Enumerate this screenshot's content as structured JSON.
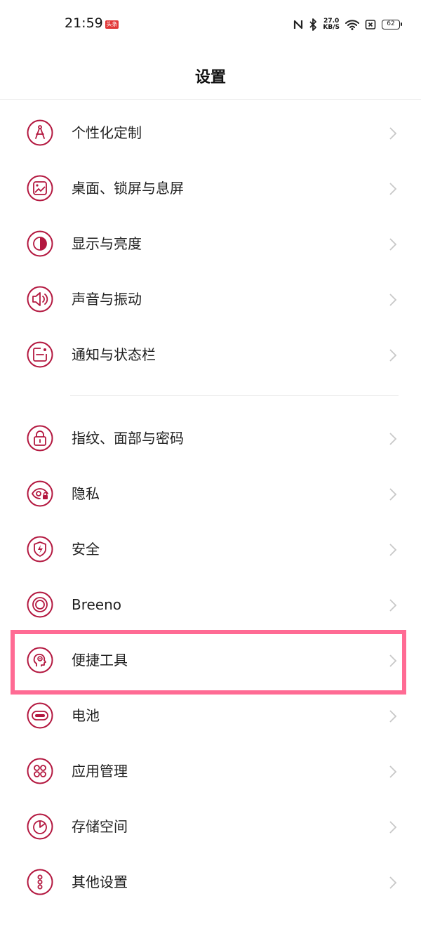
{
  "status_bar": {
    "time": "21:59",
    "app_badge": "头条",
    "net_speed_value": "27.0",
    "net_speed_unit": "KB/S",
    "battery": "62"
  },
  "header": {
    "title": "设置"
  },
  "accent_color": "#b3173f",
  "groups": [
    {
      "items": [
        {
          "label": "个性化定制",
          "icon": "compass-icon"
        },
        {
          "label": "桌面、锁屏与息屏",
          "icon": "wallpaper-icon"
        },
        {
          "label": "显示与亮度",
          "icon": "contrast-icon"
        },
        {
          "label": "声音与振动",
          "icon": "speaker-icon"
        },
        {
          "label": "通知与状态栏",
          "icon": "notification-icon"
        }
      ]
    },
    {
      "items": [
        {
          "label": "指纹、面部与密码",
          "icon": "lock-icon"
        },
        {
          "label": "隐私",
          "icon": "privacy-eye-icon"
        },
        {
          "label": "安全",
          "icon": "shield-icon"
        },
        {
          "label": "Breeno",
          "icon": "breeno-icon"
        },
        {
          "label": "便捷工具",
          "icon": "head-icon"
        },
        {
          "label": "电池",
          "icon": "battery-icon"
        },
        {
          "label": "应用管理",
          "icon": "apps-icon"
        },
        {
          "label": "存储空间",
          "icon": "storage-icon"
        },
        {
          "label": "其他设置",
          "icon": "more-icon"
        }
      ]
    }
  ]
}
